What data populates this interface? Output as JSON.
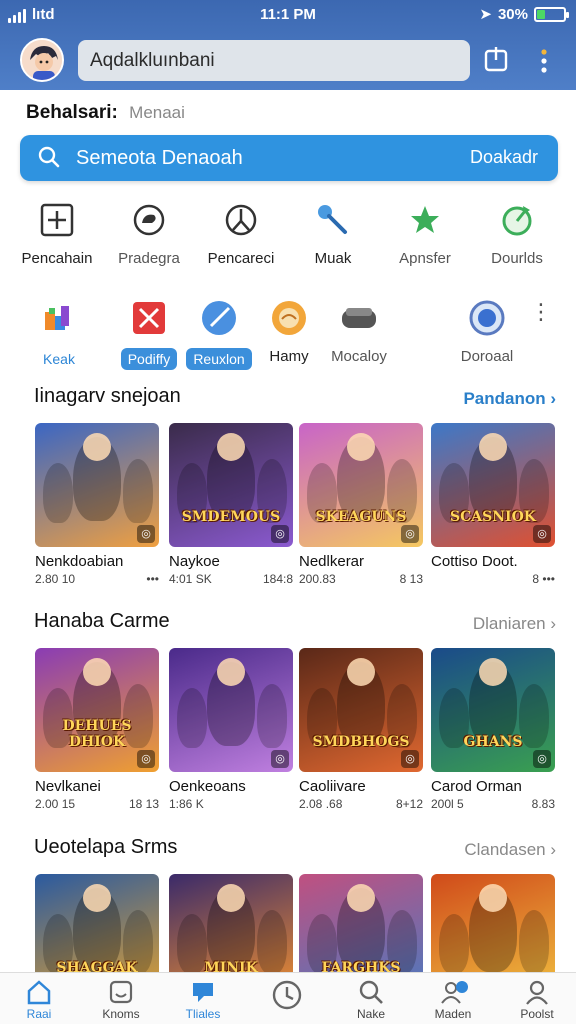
{
  "status": {
    "carrier": "lıtd",
    "time": "11:1 PM",
    "battery_text": "30%",
    "battery_level": 0.3
  },
  "header": {
    "search_value": "Aqdalkluınbani"
  },
  "saved": {
    "label": "Behalsari:",
    "value": "Menaai"
  },
  "search": {
    "placeholder": "Semeota Denaoah",
    "right_label": "Doakadr"
  },
  "categories_row1": [
    {
      "label": "Pencahain",
      "icon": "plus-box-icon"
    },
    {
      "label": "Pradegra",
      "icon": "chat-bubble-icon"
    },
    {
      "label": "Pencareci",
      "icon": "clock-person-icon"
    },
    {
      "label": "Muak",
      "icon": "key-icon"
    },
    {
      "label": "Apnsfer",
      "icon": "star-badge-icon"
    },
    {
      "label": "Dourlds",
      "icon": "refresh-icon"
    }
  ],
  "categories_row2": [
    {
      "label": "Keak",
      "icon": "puzzle-icon"
    },
    {
      "label": "Podiffy",
      "icon": "crossed-swords-icon"
    },
    {
      "label": "Reuxlon",
      "icon": "sword-icon"
    },
    {
      "label": "Hamy",
      "icon": "sun-orb-icon"
    },
    {
      "label": "Mocaloy",
      "icon": "gamepad-icon"
    },
    {
      "label": "Doroaal",
      "icon": "ring-icon"
    }
  ],
  "sections": [
    {
      "title": "Iinagarv snejoan",
      "link": "Pandanon",
      "games": [
        {
          "name": "Nenkdoabian",
          "size": "2.80 10",
          "extra": "•••",
          "thumb_title": "",
          "colors": [
            "#3a66c4",
            "#f0a040"
          ]
        },
        {
          "name": "Naykoe",
          "size": "4:01 SK",
          "extra": "184:8",
          "thumb_title": "SMDEMOUS",
          "colors": [
            "#3a2b4a",
            "#8b5ad0"
          ]
        },
        {
          "name": "Nedlkerar",
          "size": "200.83",
          "extra": "8 13",
          "thumb_title": "SKEAGUNS",
          "colors": [
            "#c864c8",
            "#f5c860"
          ]
        },
        {
          "name": "Cottiso Doot.",
          "size": "",
          "extra": "8 •••",
          "thumb_title": "SCASNIOK",
          "colors": [
            "#3c78c8",
            "#e05030"
          ]
        }
      ]
    },
    {
      "title": "Hanaba Carme",
      "link": "Dlaniaren",
      "games": [
        {
          "name": "Nevlkanei",
          "size": "2.00 15",
          "extra": "18 13",
          "thumb_title": "DEHUES DHIOK",
          "colors": [
            "#8a3cb4",
            "#f0a030"
          ]
        },
        {
          "name": "Oenkeoans",
          "size": "1:86 K",
          "extra": "",
          "thumb_title": "",
          "colors": [
            "#4a2a8a",
            "#c080e0"
          ]
        },
        {
          "name": "Caoliivare",
          "size": "2.08 .68",
          "extra": "8+12",
          "thumb_title": "SMDBHOGS",
          "colors": [
            "#5a2818",
            "#e06830"
          ]
        },
        {
          "name": "Carod Orman",
          "size": "200l 5",
          "extra": "8.83",
          "thumb_title": "GHANS",
          "colors": [
            "#1a4a8a",
            "#3aa050"
          ]
        }
      ]
    },
    {
      "title": "Ueotelapa Srms",
      "link": "Clandasen",
      "games": [
        {
          "name": "",
          "size": "",
          "extra": "",
          "thumb_title": "SHAGGAK",
          "colors": [
            "#2a5aa0",
            "#e0a030"
          ]
        },
        {
          "name": "",
          "size": "",
          "extra": "",
          "thumb_title": "MINIK",
          "colors": [
            "#3a2a6a",
            "#f09030"
          ]
        },
        {
          "name": "",
          "size": "",
          "extra": "",
          "thumb_title": "FARGHKS",
          "colors": [
            "#c05080",
            "#4a7ac0"
          ]
        },
        {
          "name": "",
          "size": "",
          "extra": "",
          "thumb_title": "",
          "colors": [
            "#d04a1a",
            "#f0c040"
          ]
        }
      ]
    }
  ],
  "bottom_nav": [
    {
      "label": "Raai",
      "icon": "home-icon",
      "active": true
    },
    {
      "label": "Knoms",
      "icon": "face-box-icon",
      "active": false
    },
    {
      "label": "Tliales",
      "icon": "shield-chat-icon",
      "active": true
    },
    {
      "label": "",
      "icon": "clock-icon",
      "active": false
    },
    {
      "label": "Nake",
      "icon": "search-icon",
      "active": false
    },
    {
      "label": "Maden",
      "icon": "people-icon",
      "active": false
    },
    {
      "label": "Poolst",
      "icon": "person-icon",
      "active": false
    }
  ],
  "colors": {
    "header": "#3c68b1",
    "accent": "#2f93e0",
    "link": "#2a7fc9"
  }
}
